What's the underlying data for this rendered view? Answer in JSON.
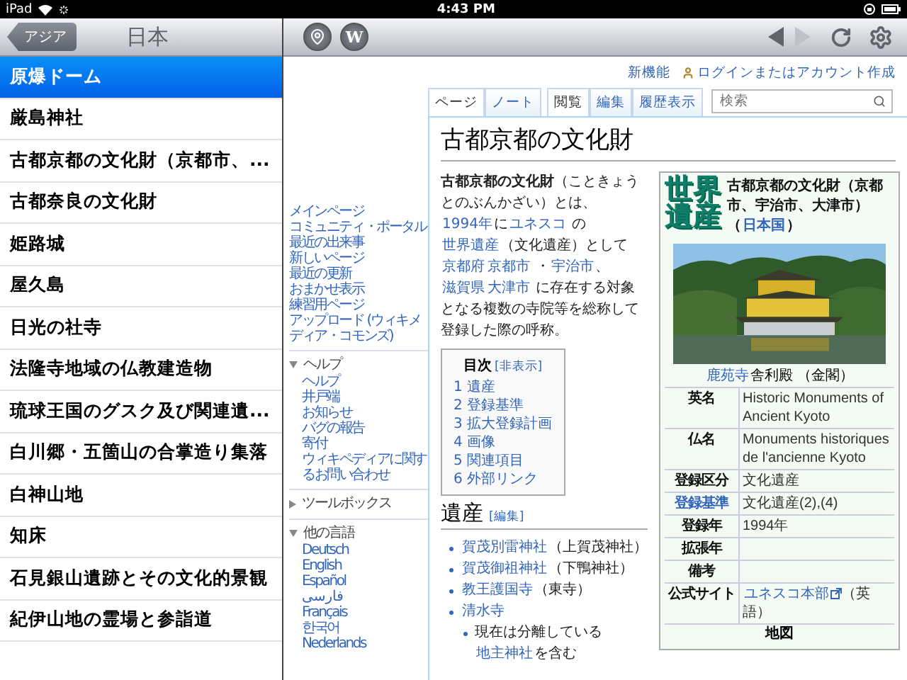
{
  "status_bar": {
    "device": "iPad",
    "time": "4:43 PM"
  },
  "sidebar": {
    "back_button": "アジア",
    "title": "日本",
    "items": [
      {
        "label": "原爆ドーム",
        "selected": true
      },
      {
        "label": "厳島神社",
        "selected": false
      },
      {
        "label": "古都京都の文化財（京都市、...",
        "selected": false
      },
      {
        "label": "古都奈良の文化財",
        "selected": false
      },
      {
        "label": "姫路城",
        "selected": false
      },
      {
        "label": "屋久島",
        "selected": false
      },
      {
        "label": "日光の社寺",
        "selected": false
      },
      {
        "label": "法隆寺地域の仏教建造物",
        "selected": false
      },
      {
        "label": "琉球王国のグスク及び関連遺...",
        "selected": false
      },
      {
        "label": "白川郷・五箇山の合掌造り集落",
        "selected": false
      },
      {
        "label": "白神山地",
        "selected": false
      },
      {
        "label": "知床",
        "selected": false
      },
      {
        "label": "石見銀山遺跡とその文化的景観",
        "selected": false
      },
      {
        "label": "紀伊山地の霊場と参詣道",
        "selected": false
      }
    ]
  },
  "toolbar": {
    "wiki_button": "W",
    "back_enabled": true,
    "forward_enabled": false
  },
  "wiki": {
    "top_links": [
      {
        "label": "新機能",
        "icon": false
      },
      {
        "label": "ログインまたはアカウント作成",
        "icon": true
      }
    ],
    "nav": {
      "main": [
        "メインページ",
        "コミュニティ・ポータル",
        "最近の出来事",
        "新しいページ",
        "最近の更新",
        "おまかせ表示",
        "練習用ページ",
        "アップロード (ウィキメディア・コモンズ)"
      ],
      "sections": [
        {
          "title": "ヘルプ",
          "expanded": true,
          "items": [
            "ヘルプ",
            "井戸端",
            "お知らせ",
            "バグの報告",
            "寄付",
            "ウィキペディアに関するお問い合わせ"
          ]
        },
        {
          "title": "ツールボックス",
          "expanded": false
        },
        {
          "title": "他の言語",
          "expanded": true,
          "items": [
            "Deutsch",
            "English",
            "Español",
            "فارسی",
            "Français",
            "한국어",
            "Nederlands"
          ]
        }
      ]
    },
    "tabs_left": [
      {
        "label": "ページ",
        "selected": true
      },
      {
        "label": "ノート",
        "selected": false
      }
    ],
    "tabs_right": [
      {
        "label": "閲覧",
        "selected": true
      },
      {
        "label": "編集",
        "selected": false
      },
      {
        "label": "履歴表示",
        "selected": false
      }
    ],
    "search": {
      "placeholder": "検索"
    },
    "title": "古都京都の文化財",
    "intro": [
      {
        "kind": "bold",
        "text": "古都京都の文化財"
      },
      {
        "kind": "text",
        "text": "（こときょうとのぶんかざい）とは、"
      },
      {
        "kind": "link",
        "text": "1994年"
      },
      {
        "kind": "text",
        "text": "に"
      },
      {
        "kind": "link",
        "text": "ユネスコ"
      },
      {
        "kind": "text",
        "text": " の "
      },
      {
        "kind": "link",
        "text": "世界遺産"
      },
      {
        "kind": "text",
        "text": "（文化遺産）として"
      },
      {
        "kind": "link",
        "text": "京都府"
      },
      {
        "kind": "link",
        "text": "京都市"
      },
      {
        "kind": "text",
        "text": " ・"
      },
      {
        "kind": "link",
        "text": "宇治市"
      },
      {
        "kind": "text",
        "text": "、"
      },
      {
        "kind": "link",
        "text": "滋賀県"
      },
      {
        "kind": "link",
        "text": "大津市"
      },
      {
        "kind": "text",
        "text": " に存在する対象となる複数の寺院等を総称して登録した際の呼称。"
      }
    ],
    "toc": {
      "title": "目次",
      "toggle": "[非表示]",
      "items": [
        "1 遺産",
        "2 登録基準",
        "3 拡大登録計画",
        "4 画像",
        "5 関連項目",
        "6 外部リンク"
      ]
    },
    "section": {
      "heading": "遺産",
      "edit": "[編集]",
      "items": [
        {
          "segments": [
            {
              "kind": "link",
              "text": "賀茂別雷神社"
            },
            {
              "kind": "text",
              "text": "（上賀茂神社）"
            }
          ]
        },
        {
          "segments": [
            {
              "kind": "link",
              "text": "賀茂御祖神社"
            },
            {
              "kind": "text",
              "text": "（下鴨神社）"
            }
          ]
        },
        {
          "segments": [
            {
              "kind": "link",
              "text": "教王護国寺"
            },
            {
              "kind": "text",
              "text": "（東寺）"
            }
          ]
        },
        {
          "segments": [
            {
              "kind": "link",
              "text": "清水寺"
            }
          ],
          "children": [
            {
              "segments": [
                {
                  "kind": "text",
                  "text": "現在は分離している "
                },
                {
                  "kind": "link",
                  "text": "地主神社"
                },
                {
                  "kind": "text",
                  "text": "を含む"
                }
              ]
            }
          ]
        }
      ]
    },
    "infobox": {
      "logo": "世界遺産",
      "title": [
        {
          "kind": "text",
          "text": "古都京都の文化財（京都市、宇治市、大津市）"
        },
        {
          "kind": "text",
          "text": "（"
        },
        {
          "kind": "link",
          "text": "日本国"
        },
        {
          "kind": "text",
          "text": "）"
        }
      ],
      "caption": [
        {
          "kind": "link",
          "text": "鹿苑寺"
        },
        {
          "kind": "text",
          "text": "舎利殿 （金閣）"
        }
      ],
      "rows": [
        {
          "label": "英名",
          "label_link": false,
          "value": [
            {
              "kind": "text",
              "text": "Historic Monuments of Ancient Kyoto"
            }
          ]
        },
        {
          "label": "仏名",
          "label_link": false,
          "value": [
            {
              "kind": "text",
              "text": "Monuments historiques de l'ancienne Kyoto"
            }
          ]
        },
        {
          "label": "登録区分",
          "label_link": false,
          "value": [
            {
              "kind": "text",
              "text": "文化遺産"
            }
          ]
        },
        {
          "label": "登録基準",
          "label_link": true,
          "value": [
            {
              "kind": "text",
              "text": "文化遺産(2),(4)"
            }
          ]
        },
        {
          "label": "登録年",
          "label_link": false,
          "value": [
            {
              "kind": "text",
              "text": "1994年"
            }
          ]
        },
        {
          "label": "拡張年",
          "label_link": false
        },
        {
          "label": "備考",
          "label_link": false
        },
        {
          "label": "公式サイト",
          "label_link": false,
          "value": [
            {
              "kind": "extlink",
              "text": "ユネスコ本部"
            },
            {
              "kind": "text",
              "text": "（英語）"
            }
          ]
        }
      ],
      "footer": "地図"
    }
  }
}
